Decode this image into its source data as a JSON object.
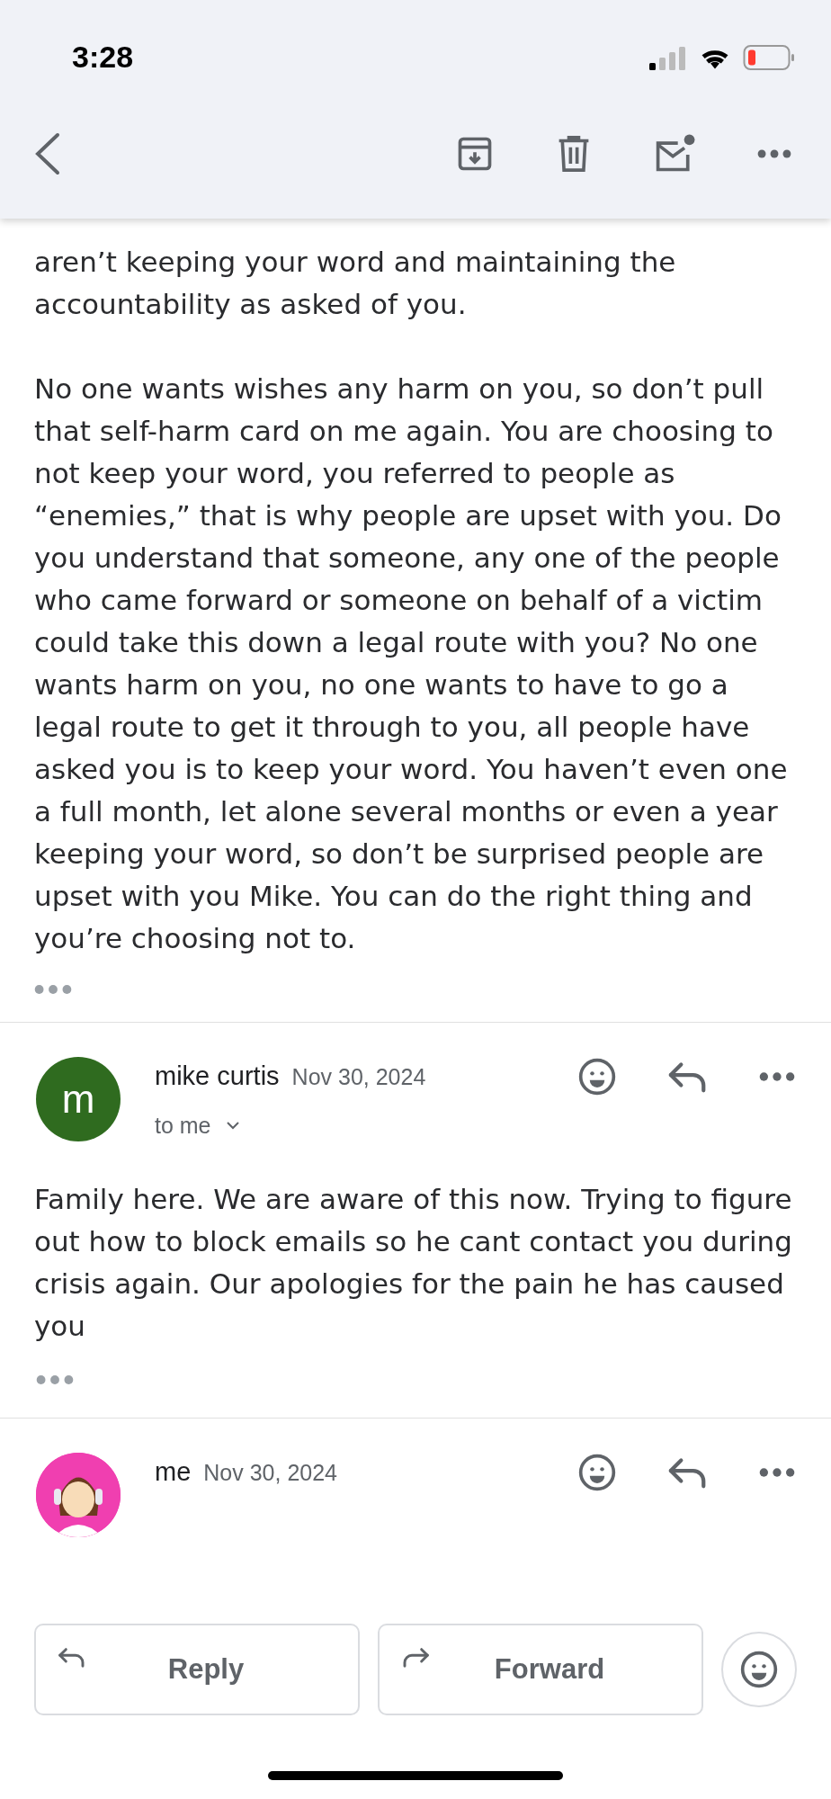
{
  "status_bar": {
    "time": "3:28"
  },
  "top_message": {
    "paragraphs": [
      "aren’t keeping your word and maintaining the accountability as asked of you.",
      "No one wants wishes any harm on you, so don’t pull that self-harm card on me again. You are choosing to not keep your word, you referred to people as “enemies,” that is why people are upset with you. Do you understand that someone, any one of the people who came forward or someone on behalf of a victim could take this down a legal route with you? No one wants harm on you, no one wants to have to go a legal route to get it through to you, all people have asked you is to keep your word. You haven’t even one a full month, let alone several months or even a year keeping your word, so don’t be surprised people are upset with you Mike. You can do the right thing and you’re choosing not to."
    ]
  },
  "messages": [
    {
      "kind": "letter",
      "sender": "mike curtis",
      "date": "Nov 30, 2024",
      "recipient": "to me",
      "avatar_letter": "m",
      "color": "#2f6b1f",
      "body": "Family here. We are aware of this now.  Trying to figure out how to block emails so he cant contact you during crisis again. Our apologies for the pain he has caused you"
    },
    {
      "kind": "picture",
      "sender": "me",
      "date": "Nov 30, 2024",
      "color": "#f03fb0"
    }
  ],
  "actions": [
    {
      "kind": "reply",
      "label": "Reply"
    },
    {
      "kind": "forward",
      "label": "Forward"
    }
  ]
}
